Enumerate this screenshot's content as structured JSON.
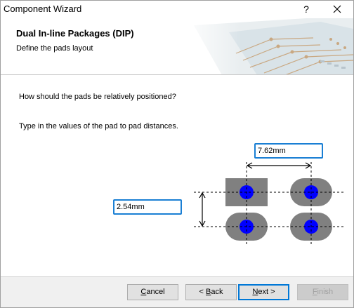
{
  "window": {
    "title": "Component Wizard",
    "help_label": "?",
    "close_label": "✕"
  },
  "header": {
    "title": "Dual In-line Packages (DIP)",
    "subtitle": "Define the pads layout"
  },
  "main": {
    "question": "How should the pads be relatively positioned?",
    "instruction": "Type in the values of the pad to pad distances.",
    "horizontal_distance": "7.62mm",
    "vertical_distance": "2.54mm"
  },
  "buttons": {
    "cancel": {
      "mnemonic": "C",
      "rest": "ancel"
    },
    "back": {
      "prefix": "< ",
      "mnemonic": "B",
      "rest": "ack"
    },
    "next": {
      "mnemonic": "N",
      "rest": "ext >"
    },
    "finish": {
      "mnemonic": "F",
      "rest": "inish"
    }
  },
  "colors": {
    "field_border": "#1a7fd4",
    "pad_fill": "#808080",
    "hole_fill": "#0000ff",
    "default_button_border": "#0078d7"
  }
}
